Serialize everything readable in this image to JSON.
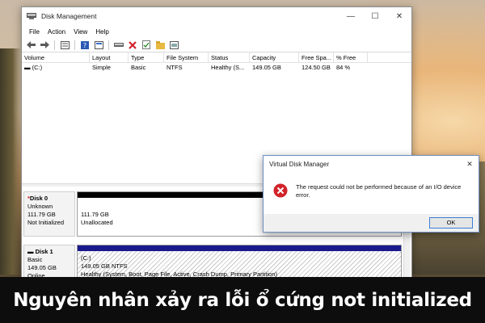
{
  "window": {
    "title": "Disk Management",
    "minimize_icon": "minimize-icon",
    "maximize_icon": "maximize-icon",
    "close_icon": "close-icon"
  },
  "menu": [
    "File",
    "Action",
    "View",
    "Help"
  ],
  "toolbar_icons": [
    "back-arrow-icon",
    "forward-arrow-icon",
    "console-tree-icon",
    "help-icon",
    "properties-icon",
    "connect-drive-icon",
    "delete-icon",
    "check-icon",
    "folder-icon",
    "disk-icon"
  ],
  "volume_table": {
    "columns": [
      "Volume",
      "Layout",
      "Type",
      "File System",
      "Status",
      "Capacity",
      "Free Spa...",
      "% Free"
    ],
    "rows": [
      {
        "volume": "(C:)",
        "layout": "Simple",
        "type": "Basic",
        "file_system": "NTFS",
        "status": "Healthy (S...",
        "capacity": "149.05 GB",
        "free_space": "124.50 GB",
        "pct_free": "84 %"
      }
    ]
  },
  "disks": [
    {
      "name": "Disk 0",
      "type": "Unknown",
      "size": "111.79 GB",
      "state": "Not Initialized",
      "partition": {
        "size": "111.79 GB",
        "label": "Unallocated"
      }
    },
    {
      "name": "Disk 1",
      "type": "Basic",
      "size": "149.05 GB",
      "state": "Online",
      "partition": {
        "label": "(C:)",
        "size_fs": "149.05 GB NTFS",
        "status": "Healthy (System, Boot, Page File, Active, Crash Dump, Primary Partition)"
      }
    }
  ],
  "dialog": {
    "title": "Virtual Disk Manager",
    "message": "The request could not be performed because of an I/O device error.",
    "ok_label": "OK",
    "icon": "error-icon"
  },
  "caption": "Nguyên nhân xảy ra lỗi ổ cứng not initialized",
  "colors": {
    "disk1_bar": "#1a1a8c",
    "disk0_bar": "#000000",
    "error_red": "#d2232a",
    "caption_bg": "#0d0d0d"
  }
}
